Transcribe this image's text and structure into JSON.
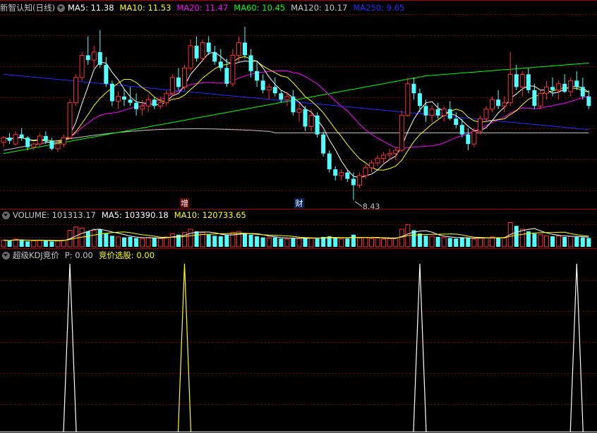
{
  "colors": {
    "up": "#ff3232",
    "down": "#54ffff",
    "grid": "#7a0000",
    "divider": "#a00000",
    "ma5": "#ffffff",
    "ma10": "#ffff00",
    "ma20": "#ff00ff",
    "ma60": "#00ff00",
    "ma120": "#c8c8c8",
    "ma250": "#2a2aff",
    "kdj": "#ffff00",
    "kdj2": "#ffffff"
  },
  "price_panel": {
    "title": "新智认知(日线)",
    "indicators": [
      {
        "label": "MA5: 11.38",
        "color": "#ffffff"
      },
      {
        "label": "MA10: 11.53",
        "color": "#ffff00"
      },
      {
        "label": "MA20: 11.47",
        "color": "#ff00ff"
      },
      {
        "label": "MA60: 10.45",
        "color": "#00ff00"
      },
      {
        "label": "MA120: 10.17",
        "color": "#c8c8c8"
      },
      {
        "label": "MA250: 9.65",
        "color": "#2a2aff"
      }
    ],
    "low_label": "8.43",
    "marker_zeng": "增",
    "marker_cai": "财"
  },
  "volume_panel": {
    "title": "VOLUME: 101313.17",
    "indicators": [
      {
        "label": "MA5: 103390.18",
        "color": "#ffffff"
      },
      {
        "label": "MA10: 120733.65",
        "color": "#ffff00"
      }
    ]
  },
  "kdj_panel": {
    "title": "超级KDJ竞价",
    "indicators": [
      {
        "label": "P: 0.00",
        "color": "#c8c8c8"
      },
      {
        "label": "竞价选股: 0.00",
        "color": "#ffff00"
      }
    ]
  },
  "chart_data": [
    {
      "type": "candlestick",
      "title": "新智认知(日线)",
      "low_marker": 8.43,
      "candles_ohlc": [
        [
          10.25,
          10.45,
          10.1,
          10.4
        ],
        [
          10.4,
          10.55,
          10.2,
          10.3
        ],
        [
          10.2,
          10.6,
          10.15,
          10.5
        ],
        [
          10.5,
          10.7,
          10.3,
          10.4
        ],
        [
          10.4,
          10.45,
          10.0,
          10.1
        ],
        [
          10.1,
          10.25,
          10.0,
          10.2
        ],
        [
          10.2,
          10.55,
          10.1,
          10.45
        ],
        [
          10.45,
          10.6,
          10.2,
          10.3
        ],
        [
          10.3,
          10.4,
          10.0,
          10.05
        ],
        [
          10.05,
          10.25,
          9.95,
          10.2
        ],
        [
          10.2,
          10.5,
          10.1,
          10.4
        ],
        [
          10.4,
          11.6,
          10.35,
          11.5
        ],
        [
          11.5,
          12.4,
          11.4,
          12.3
        ],
        [
          12.3,
          13.1,
          12.2,
          13.0
        ],
        [
          13.0,
          13.6,
          12.7,
          12.85
        ],
        [
          12.85,
          13.3,
          12.6,
          13.1
        ],
        [
          13.1,
          13.8,
          12.6,
          12.7
        ],
        [
          12.7,
          12.95,
          12.0,
          12.1
        ],
        [
          12.1,
          12.2,
          11.4,
          11.55
        ],
        [
          11.55,
          11.85,
          11.3,
          11.7
        ],
        [
          11.7,
          11.95,
          11.4,
          11.6
        ],
        [
          11.6,
          12.0,
          11.4,
          11.5
        ],
        [
          11.5,
          11.8,
          11.1,
          11.3
        ],
        [
          11.3,
          11.6,
          11.1,
          11.4
        ],
        [
          11.4,
          11.75,
          11.2,
          11.6
        ],
        [
          11.6,
          11.7,
          11.3,
          11.4
        ],
        [
          11.4,
          11.7,
          11.3,
          11.5
        ],
        [
          11.5,
          11.9,
          11.4,
          11.8
        ],
        [
          11.8,
          12.4,
          11.7,
          12.3
        ],
        [
          12.3,
          12.6,
          11.9,
          12.0
        ],
        [
          12.0,
          12.7,
          11.9,
          12.6
        ],
        [
          12.6,
          13.5,
          12.5,
          13.3
        ],
        [
          13.3,
          13.6,
          12.8,
          12.9
        ],
        [
          12.9,
          13.5,
          12.8,
          13.4
        ],
        [
          13.4,
          13.6,
          13.0,
          13.1
        ],
        [
          13.1,
          13.3,
          12.7,
          12.8
        ],
        [
          12.8,
          13.2,
          12.5,
          12.6
        ],
        [
          12.6,
          12.9,
          12.0,
          12.1
        ],
        [
          12.1,
          13.2,
          12.0,
          13.0
        ],
        [
          13.0,
          13.6,
          12.8,
          13.4
        ],
        [
          13.4,
          13.9,
          12.9,
          13.0
        ],
        [
          13.0,
          13.2,
          12.3,
          12.5
        ],
        [
          12.5,
          12.8,
          12.0,
          12.2
        ],
        [
          12.2,
          12.4,
          11.8,
          11.9
        ],
        [
          11.9,
          12.1,
          11.6,
          12.0
        ],
        [
          12.0,
          12.3,
          11.7,
          11.8
        ],
        [
          11.8,
          11.9,
          11.5,
          11.6
        ],
        [
          11.6,
          11.85,
          11.4,
          11.7
        ],
        [
          11.7,
          11.9,
          11.1,
          11.2
        ],
        [
          11.2,
          11.5,
          10.9,
          11.3
        ],
        [
          11.3,
          11.4,
          10.6,
          10.75
        ],
        [
          10.75,
          11.3,
          10.6,
          11.1
        ],
        [
          11.1,
          11.2,
          10.4,
          10.5
        ],
        [
          10.5,
          10.6,
          9.8,
          9.9
        ],
        [
          9.9,
          10.0,
          9.3,
          9.4
        ],
        [
          9.4,
          9.5,
          9.05,
          9.2
        ],
        [
          9.2,
          9.4,
          9.05,
          9.3
        ],
        [
          9.3,
          9.4,
          9.0,
          9.1
        ],
        [
          9.1,
          9.3,
          8.43,
          8.9
        ],
        [
          8.9,
          9.3,
          8.8,
          9.2
        ],
        [
          9.2,
          9.55,
          9.1,
          9.45
        ],
        [
          9.45,
          9.7,
          9.3,
          9.6
        ],
        [
          9.6,
          9.85,
          9.5,
          9.75
        ],
        [
          9.75,
          9.95,
          9.55,
          9.85
        ],
        [
          9.85,
          10.05,
          9.7,
          9.9
        ],
        [
          9.9,
          10.1,
          9.7,
          10.0
        ],
        [
          10.0,
          11.25,
          9.95,
          11.1
        ],
        [
          11.1,
          12.3,
          11.05,
          12.1
        ],
        [
          12.1,
          12.3,
          11.6,
          11.8
        ],
        [
          11.8,
          11.95,
          11.2,
          11.4
        ],
        [
          11.4,
          11.6,
          10.9,
          11.1
        ],
        [
          11.1,
          11.4,
          10.9,
          11.3
        ],
        [
          11.3,
          11.5,
          11.0,
          11.1
        ],
        [
          11.1,
          11.4,
          10.9,
          11.3
        ],
        [
          11.3,
          11.55,
          10.95,
          11.0
        ],
        [
          11.0,
          11.2,
          10.7,
          10.8
        ],
        [
          10.8,
          11.0,
          10.4,
          10.5
        ],
        [
          10.5,
          10.7,
          10.0,
          10.2
        ],
        [
          10.2,
          10.7,
          10.1,
          10.6
        ],
        [
          10.6,
          11.1,
          10.5,
          11.0
        ],
        [
          11.0,
          11.4,
          10.9,
          11.3
        ],
        [
          11.3,
          11.7,
          11.2,
          11.6
        ],
        [
          11.6,
          11.9,
          11.3,
          11.4
        ],
        [
          11.4,
          11.7,
          11.2,
          11.5
        ],
        [
          11.5,
          13.1,
          11.4,
          12.4
        ],
        [
          12.4,
          12.7,
          11.9,
          12.0
        ],
        [
          12.0,
          12.5,
          11.7,
          12.4
        ],
        [
          12.4,
          12.6,
          11.8,
          11.9
        ],
        [
          11.9,
          12.1,
          11.3,
          11.4
        ],
        [
          11.4,
          11.9,
          11.3,
          11.8
        ],
        [
          11.8,
          12.2,
          11.6,
          12.0
        ],
        [
          12.0,
          12.3,
          11.7,
          11.9
        ],
        [
          11.9,
          12.2,
          11.6,
          12.1
        ],
        [
          12.1,
          12.4,
          11.8,
          11.85
        ],
        [
          11.85,
          12.3,
          11.7,
          12.2
        ],
        [
          12.2,
          12.5,
          11.9,
          12.0
        ],
        [
          12.0,
          12.3,
          11.6,
          11.7
        ],
        [
          11.7,
          11.9,
          11.3,
          11.4
        ]
      ],
      "moving_averages": [
        {
          "name": "MA5",
          "last": 11.38
        },
        {
          "name": "MA10",
          "last": 11.53
        },
        {
          "name": "MA20",
          "last": 11.47
        },
        {
          "name": "MA60",
          "last": 10.45
        },
        {
          "name": "MA120",
          "last": 10.17
        },
        {
          "name": "MA250",
          "last": 9.65
        }
      ]
    },
    {
      "type": "bar",
      "title": "VOLUME: 101313.17",
      "values": [
        60,
        55,
        70,
        65,
        50,
        55,
        60,
        58,
        48,
        52,
        60,
        150,
        180,
        170,
        140,
        150,
        160,
        120,
        100,
        90,
        85,
        90,
        80,
        75,
        85,
        80,
        75,
        90,
        120,
        110,
        130,
        160,
        140,
        130,
        110,
        100,
        95,
        105,
        130,
        140,
        120,
        110,
        95,
        85,
        80,
        85,
        75,
        70,
        80,
        75,
        85,
        80,
        75,
        90,
        95,
        85,
        70,
        75,
        110,
        80,
        85,
        75,
        80,
        70,
        75,
        80,
        160,
        200,
        150,
        120,
        100,
        95,
        90,
        85,
        80,
        75,
        85,
        80,
        70,
        85,
        80,
        90,
        85,
        80,
        220,
        190,
        160,
        140,
        120,
        110,
        100,
        95,
        100,
        90,
        95,
        90,
        85,
        80
      ]
    },
    {
      "type": "line",
      "title": "超级KDJ竞价",
      "signal_spikes_at_candle": [
        11,
        30,
        69,
        95
      ],
      "ylim": [
        0,
        1
      ]
    }
  ]
}
